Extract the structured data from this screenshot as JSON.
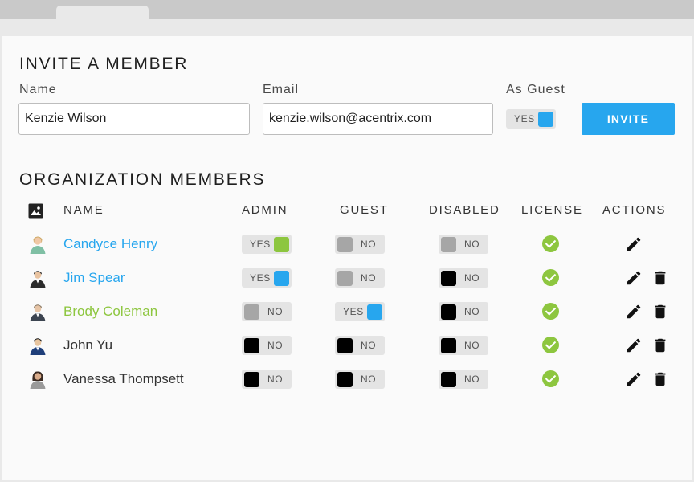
{
  "invite": {
    "title": "INVITE A MEMBER",
    "name_label": "Name",
    "name_value": "Kenzie Wilson",
    "email_label": "Email",
    "email_value": "kenzie.wilson@acentrix.com",
    "guest_label": "As Guest",
    "guest_toggle": {
      "state": "on",
      "label": "YES",
      "color": "#27a6ee"
    },
    "button_label": "INVITE"
  },
  "members": {
    "title": "ORGANIZATION MEMBERS",
    "columns": {
      "avatar_icon": "image-icon",
      "name": "NAME",
      "admin": "ADMIN",
      "guest": "GUEST",
      "disabled": "DISABLED",
      "license": "LICENSE",
      "actions": "ACTIONS"
    },
    "rows": [
      {
        "name": "Candyce Henry",
        "name_color": "#27a6ee",
        "admin": {
          "state": "on",
          "label": "YES",
          "color": "#8dc63f"
        },
        "guest": {
          "state": "off",
          "label": "NO",
          "color": "#a6a6a6"
        },
        "disabled": {
          "state": "off",
          "label": "NO",
          "color": "#a6a6a6"
        },
        "license": "check-circle-icon",
        "can_delete": false
      },
      {
        "name": "Jim Spear",
        "name_color": "#27a6ee",
        "admin": {
          "state": "on",
          "label": "YES",
          "color": "#27a6ee"
        },
        "guest": {
          "state": "off",
          "label": "NO",
          "color": "#a6a6a6"
        },
        "disabled": {
          "state": "off",
          "label": "NO",
          "color": "#000000"
        },
        "license": "check-circle-icon",
        "can_delete": true
      },
      {
        "name": "Brody Coleman",
        "name_color": "#8dc63f",
        "admin": {
          "state": "off",
          "label": "NO",
          "color": "#a6a6a6"
        },
        "guest": {
          "state": "on",
          "label": "YES",
          "color": "#27a6ee"
        },
        "disabled": {
          "state": "off",
          "label": "NO",
          "color": "#000000"
        },
        "license": "check-circle-icon",
        "can_delete": true
      },
      {
        "name": "John Yu",
        "name_color": "#333333",
        "admin": {
          "state": "off",
          "label": "NO",
          "color": "#000000"
        },
        "guest": {
          "state": "off",
          "label": "NO",
          "color": "#000000"
        },
        "disabled": {
          "state": "off",
          "label": "NO",
          "color": "#000000"
        },
        "license": "check-circle-icon",
        "can_delete": true
      },
      {
        "name": "Vanessa Thompsett",
        "name_color": "#333333",
        "admin": {
          "state": "off",
          "label": "NO",
          "color": "#000000"
        },
        "guest": {
          "state": "off",
          "label": "NO",
          "color": "#000000"
        },
        "disabled": {
          "state": "off",
          "label": "NO",
          "color": "#000000"
        },
        "license": "check-circle-icon",
        "can_delete": true
      }
    ]
  },
  "colors": {
    "accent_blue": "#27a6ee",
    "accent_green": "#8dc63f"
  }
}
